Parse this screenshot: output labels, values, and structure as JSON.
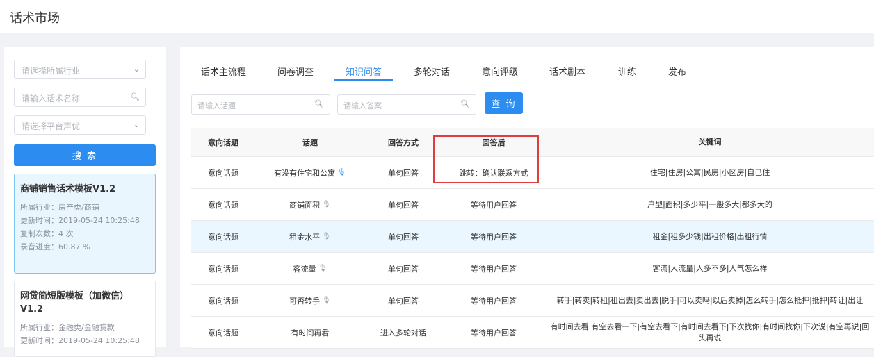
{
  "page": {
    "title": "话术市场"
  },
  "sidebar": {
    "industry_placeholder": "请选择所属行业",
    "name_placeholder": "请输入话术名称",
    "voice_placeholder": "请选择平台声优",
    "search_label": "搜 索",
    "cards": [
      {
        "title": "商铺销售话术模板V1.2",
        "industry": "所属行业：房产类/商铺",
        "updated": "更新时间：2019-05-24 10:25:48",
        "copies": "复制次数：4 次",
        "progress": "录音进度：60.87 %"
      },
      {
        "title": "网贷简短版模板（加微信）V1.2",
        "industry": "所属行业：金融类/金融贷款",
        "updated": "更新时间：2019-05-24 10:25:48"
      }
    ]
  },
  "tabs": [
    "话术主流程",
    "问卷调查",
    "知识问答",
    "多轮对话",
    "意向评级",
    "话术剧本",
    "训练",
    "发布"
  ],
  "active_tab": "知识问答",
  "filters": {
    "topic_placeholder": "请输入话题",
    "answer_placeholder": "请输入答案",
    "query_label": "查 询"
  },
  "table": {
    "headers": [
      "意向话题",
      "话题",
      "回答方式",
      "回答后",
      "关键词"
    ],
    "rows": [
      [
        "意向话题",
        "有没有住宅和公寓",
        "单句回答",
        "跳转：确认联系方式",
        "住宅|住房|公寓|民房|小区房|自己住"
      ],
      [
        "意向话题",
        "商铺面积",
        "单句回答",
        "等待用户回答",
        "户型|面积|多少平|一般多大|都多大的"
      ],
      [
        "意向话题",
        "租金水平",
        "单句回答",
        "等待用户回答",
        "租金|租多少钱|出租价格|出租行情"
      ],
      [
        "意向话题",
        "客流量",
        "单句回答",
        "等待用户回答",
        "客流|人流量|人多不多|人气怎么样"
      ],
      [
        "意向话题",
        "可否转手",
        "单句回答",
        "等待用户回答",
        "转手|转卖|转租|租出去|卖出去|脱手|可以卖吗|以后卖掉|怎么转手|怎么抵押|抵押|转让|出让"
      ],
      [
        "意向话题",
        "有时间再看",
        "进入多轮对话",
        "等待用户回答",
        "有时间去看|有空去看一下|有空去看下|有时间去看下|下次找你|有时间找你|下次说|有空再说|回头再说"
      ]
    ]
  },
  "colors": {
    "accent": "#2d8cf0",
    "highlight": "#e03e3e"
  }
}
